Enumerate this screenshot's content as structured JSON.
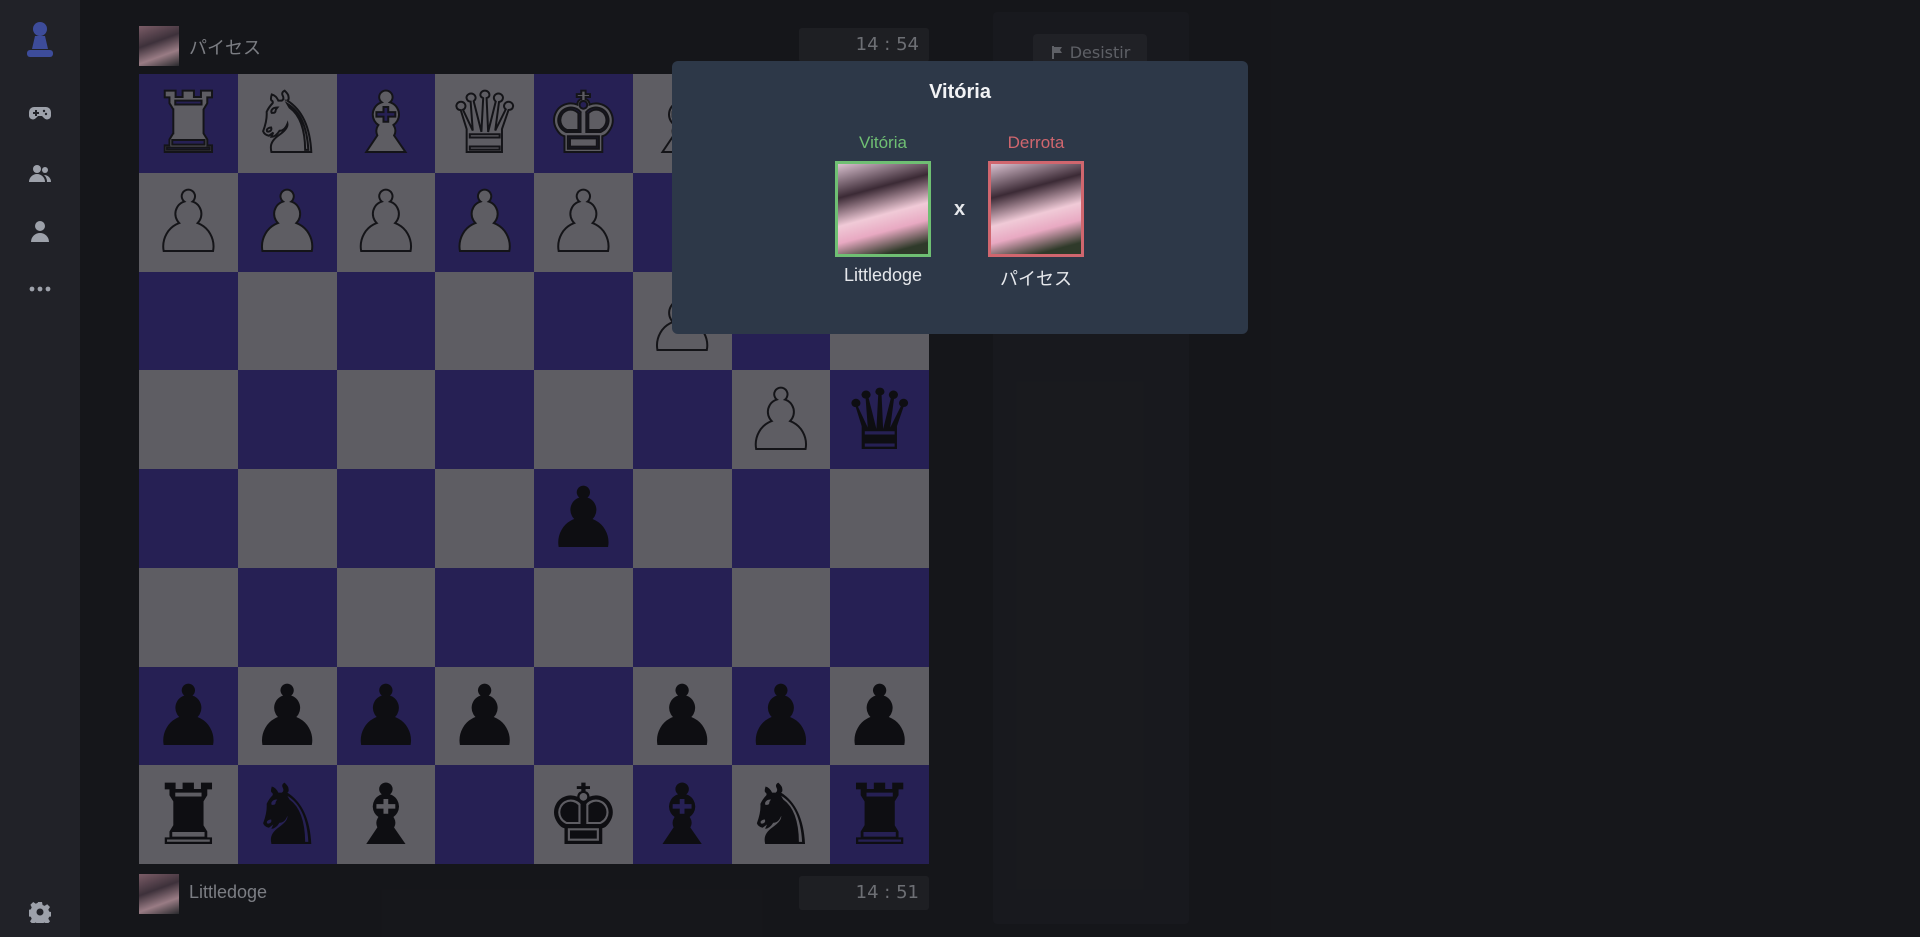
{
  "sidebar": {
    "icons": [
      "pawn-logo-icon",
      "gamepad-icon",
      "users-icon",
      "user-icon",
      "more-icon",
      "settings-icon"
    ]
  },
  "top_player": {
    "name": "パイセス",
    "clock": "14 : 54"
  },
  "bottom_player": {
    "name": "Littledoge",
    "clock": "14 : 51"
  },
  "resign_label": "Desistir",
  "board": [
    [
      "wr",
      "wn",
      "wb",
      "wq",
      "wk",
      "wb",
      "",
      ""
    ],
    [
      "wp",
      "wp",
      "wp",
      "wp",
      "wp",
      "",
      "",
      ""
    ],
    [
      "",
      "",
      "",
      "",
      "",
      "wp",
      "",
      ""
    ],
    [
      "",
      "",
      "",
      "",
      "",
      "",
      "wp",
      "bq"
    ],
    [
      "",
      "",
      "",
      "",
      "bp",
      "",
      "",
      ""
    ],
    [
      "",
      "",
      "",
      "",
      "",
      "",
      "",
      ""
    ],
    [
      "bp",
      "bp",
      "bp",
      "bp",
      "",
      "bp",
      "bp",
      "bp"
    ],
    [
      "br",
      "bn",
      "bb",
      "",
      "bk",
      "bb",
      "bn",
      "br"
    ]
  ],
  "colors": {
    "light_square": "#8d8b92",
    "dark_square": "#362d7c",
    "win": "#6fbf73",
    "loss": "#d0666e"
  },
  "modal": {
    "title": "Vitória",
    "winner": {
      "label": "Vitória",
      "name": "Littledoge"
    },
    "loser": {
      "label": "Derrota",
      "name": "パイセス"
    },
    "vs": "x"
  }
}
